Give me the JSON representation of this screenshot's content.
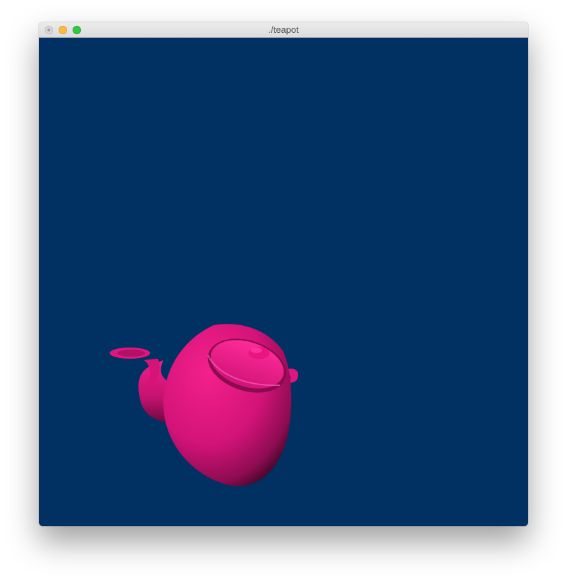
{
  "window": {
    "title": "./teapot"
  },
  "colors": {
    "background": "#003162",
    "teapot": "#e0157f"
  },
  "icons": [
    "close-icon",
    "minimize-icon",
    "zoom-icon"
  ]
}
